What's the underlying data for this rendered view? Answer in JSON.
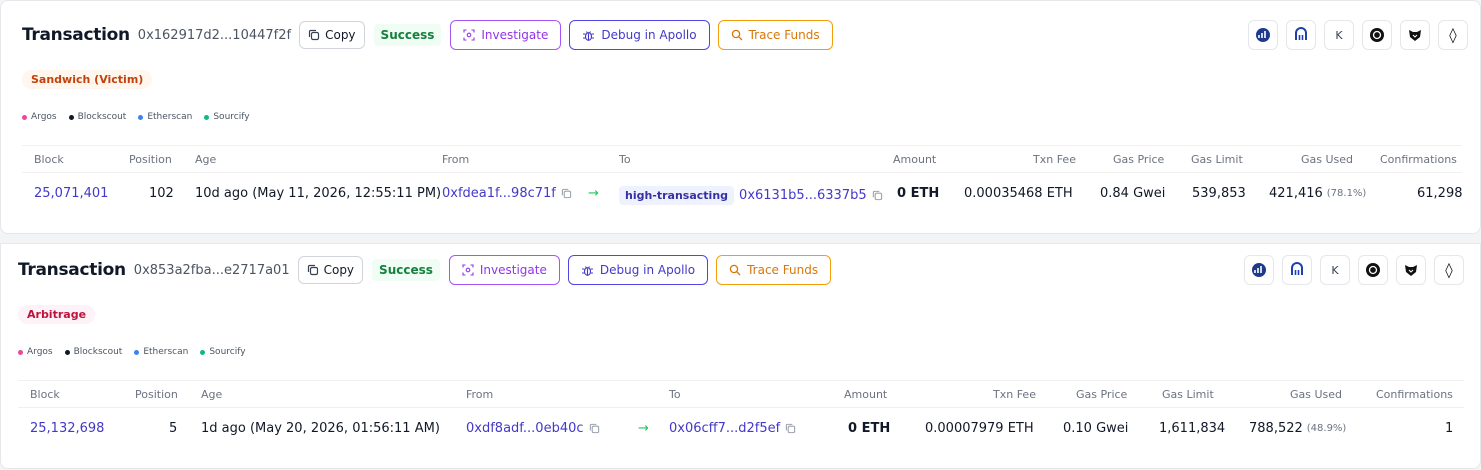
{
  "colors": {
    "success": "#15803d",
    "investigate": "#9333ea",
    "debug": "#4338ca",
    "trace": "#d97706",
    "link": "#4338ca",
    "argos": "#ec4899",
    "blockscout": "#111827",
    "etherscan": "#3b82f6",
    "sourcify": "#10b981"
  },
  "common": {
    "title": "Transaction",
    "copy_label": "Copy",
    "status_label": "Success",
    "investigate_label": "Investigate",
    "debug_label": "Debug in Apollo",
    "trace_label": "Trace Funds",
    "sources": [
      "Argos",
      "Blockscout",
      "Etherscan",
      "Sourcify"
    ],
    "ext_icons": [
      "chart-logo-icon",
      "bridge-logo-icon",
      "k-logo-icon",
      "circle-logo-icon",
      "fox-logo-icon",
      "ethereum-icon"
    ],
    "k_glyph": "K",
    "eth_glyph": "◊",
    "arrow": "→",
    "columns": {
      "block": "Block",
      "position": "Position",
      "age": "Age",
      "from": "From",
      "to": "To",
      "amount": "Amount",
      "fee": "Txn Fee",
      "gas_price": "Gas Price",
      "gas_limit": "Gas Limit",
      "gas_used": "Gas Used",
      "confirmations": "Confirmations"
    }
  },
  "transactions": [
    {
      "hash": "0x162917d2...10447f2f",
      "tag": "Sandwich (Victim)",
      "block": "25,071,401",
      "position": "102",
      "age": "10d ago (May 11, 2026, 12:55:11 PM)",
      "from": "0xfdea1f...98c71f",
      "to_label": "high-transacting",
      "to": "0x6131b5...6337b5",
      "amount": "0 ETH",
      "fee": "0.00035468 ETH",
      "gas_price": "0.84 Gwei",
      "gas_limit": "539,853",
      "gas_used": "421,416",
      "gas_used_pct": "(78.1%)",
      "confirmations": "61,298"
    },
    {
      "hash": "0x853a2fba...e2717a01",
      "tag": "Arbitrage",
      "block": "25,132,698",
      "position": "5",
      "age": "1d ago (May 20, 2026, 01:56:11 AM)",
      "from": "0xdf8adf...0eb40c",
      "to": "0x06cff7...d2f5ef",
      "amount": "0 ETH",
      "fee": "0.00007979 ETH",
      "gas_price": "0.10 Gwei",
      "gas_limit": "1,611,834",
      "gas_used": "788,522",
      "gas_used_pct": "(48.9%)",
      "confirmations": "1"
    }
  ]
}
